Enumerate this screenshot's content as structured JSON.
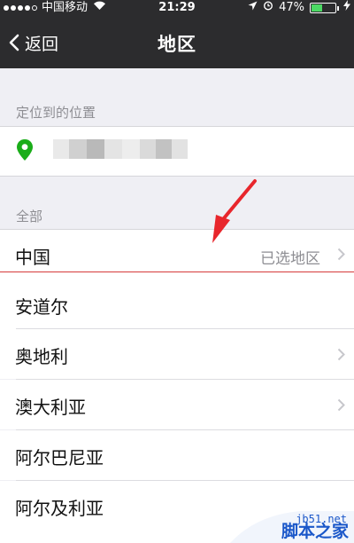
{
  "status_bar": {
    "carrier": "中国移动",
    "time": "21:29",
    "battery": "47%",
    "battery_level": 0.47
  },
  "nav": {
    "back_label": "返回",
    "title": "地区"
  },
  "location_section": {
    "header": "定位到的位置"
  },
  "all_section": {
    "header": "全部",
    "items": [
      {
        "label": "中国",
        "detail": "已选地区",
        "chevron": true
      },
      {
        "label": "安道尔",
        "chevron": false
      },
      {
        "label": "奥地利",
        "chevron": true
      },
      {
        "label": "澳大利亚",
        "chevron": true
      },
      {
        "label": "阿尔巴尼亚",
        "chevron": false
      },
      {
        "label": "阿尔及利亚",
        "chevron": false
      }
    ]
  },
  "watermark": {
    "site": "jb51.net",
    "text": "脚本之家"
  },
  "colors": {
    "navbar": "#2c2c2e",
    "background": "#efeff4",
    "location_pin": "#1aad19",
    "annotation_arrow": "#e8262c"
  }
}
